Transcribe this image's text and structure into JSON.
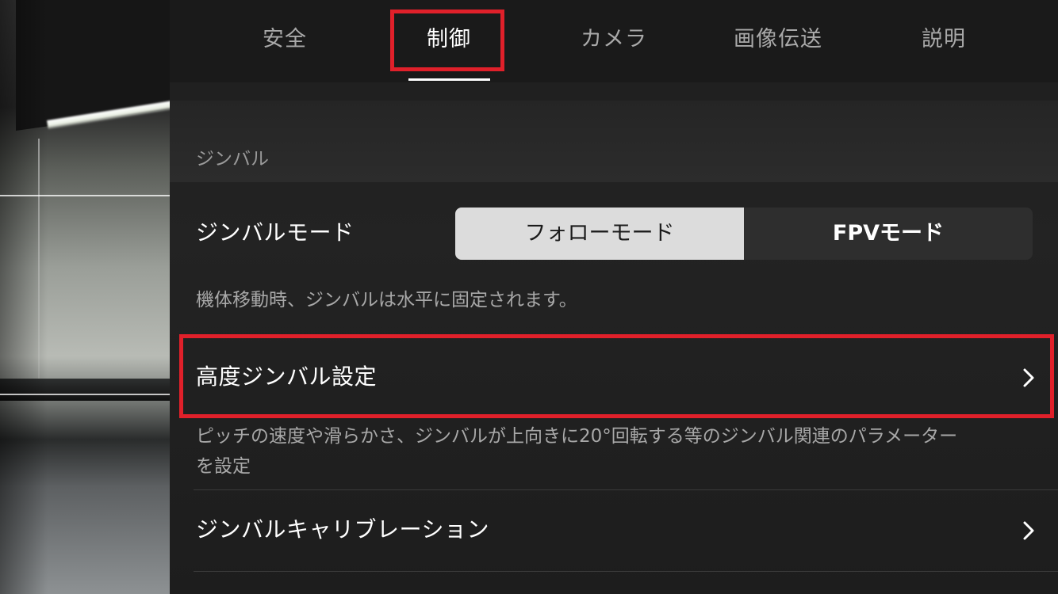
{
  "tabs": [
    {
      "label": "安全"
    },
    {
      "label": "制御"
    },
    {
      "label": "カメラ"
    },
    {
      "label": "画像伝送"
    },
    {
      "label": "説明"
    }
  ],
  "active_tab": "制御",
  "section": {
    "title": "ジンバル"
  },
  "gimbal_mode": {
    "label": "ジンバルモード",
    "options": [
      "フォローモード",
      "FPVモード"
    ],
    "selected": "フォローモード",
    "description": "機体移動時、ジンバルは水平に固定されます。"
  },
  "advanced_gimbal": {
    "label": "高度ジンバル設定",
    "description_line1": "ピッチの速度や滑らかさ、ジンバルが上向きに20°回転する等のジンバル関連のパラメーター",
    "description_line2": "を設定"
  },
  "gimbal_calibration": {
    "label": "ジンバルキャリブレーション"
  },
  "colors": {
    "highlight": "#e0202a",
    "selected_segment": "#dcdcdc",
    "background": "#1c1c1c"
  },
  "icons": {
    "row_arrow": "chevron-right-icon"
  }
}
